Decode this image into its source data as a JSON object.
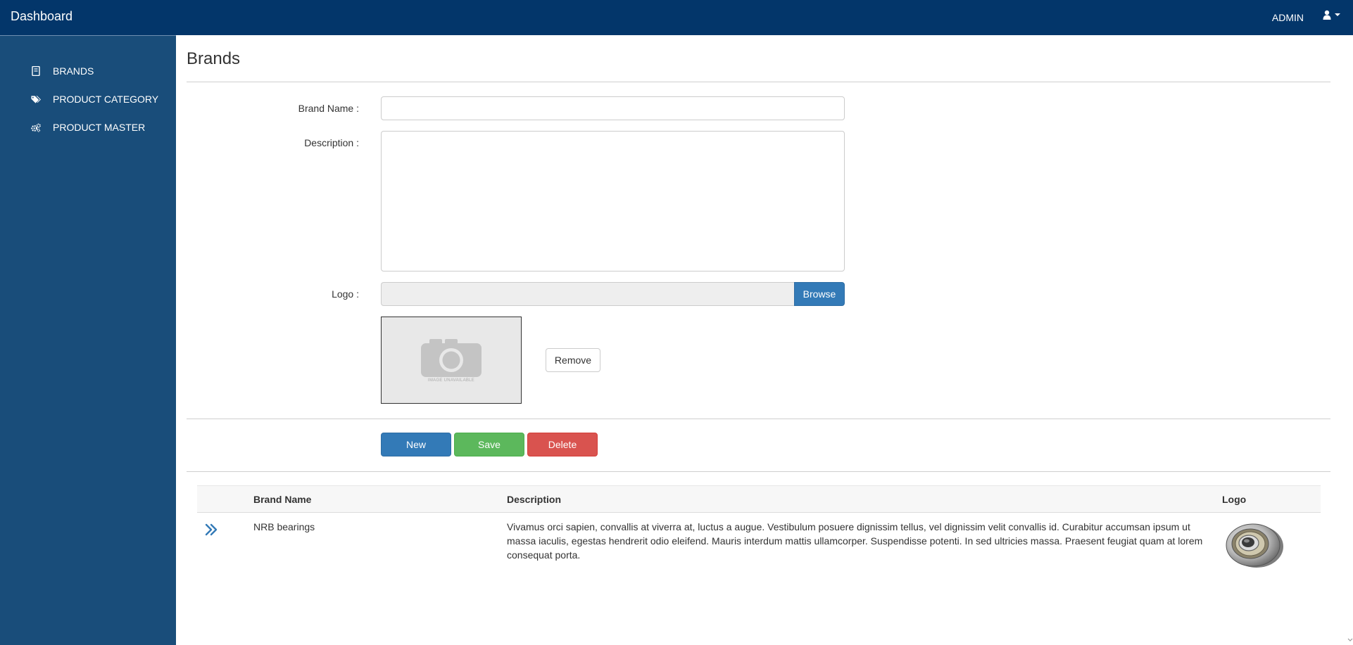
{
  "header": {
    "app_title": "Dashboard",
    "user_name": "ADMIN"
  },
  "sidebar": {
    "items": [
      {
        "label": "BRANDS",
        "icon": "book-icon"
      },
      {
        "label": "PRODUCT CATEGORY",
        "icon": "tags-icon"
      },
      {
        "label": "PRODUCT MASTER",
        "icon": "cogs-icon"
      }
    ]
  },
  "page": {
    "title": "Brands"
  },
  "form": {
    "brand_name_label": "Brand Name :",
    "brand_name_value": "",
    "description_label": "Description :",
    "description_value": "",
    "logo_label": "Logo :",
    "browse_label": "Browse",
    "preview_caption": "IMAGE UNAVAILABLE",
    "remove_label": "Remove"
  },
  "actions": {
    "new_label": "New",
    "save_label": "Save",
    "delete_label": "Delete"
  },
  "table": {
    "headers": [
      "",
      "Brand Name",
      "Description",
      "Logo"
    ],
    "rows": [
      {
        "brand_name": "NRB bearings",
        "description": "Vivamus orci sapien, convallis at viverra at, luctus a augue. Vestibulum posuere dignissim tellus, vel dignissim velit convallis id. Curabitur accumsan ipsum ut massa iaculis, egestas hendrerit odio eleifend. Mauris interdum mattis ullamcorper. Suspendisse potenti. In sed ultricies massa. Praesent feugiat quam at lorem consequat porta.",
        "logo": "bearing-image"
      }
    ]
  },
  "colors": {
    "topbar": "#03366a",
    "sidebar": "#194d7a",
    "primary": "#337ab7",
    "success": "#5cb85c",
    "danger": "#d9534f"
  }
}
